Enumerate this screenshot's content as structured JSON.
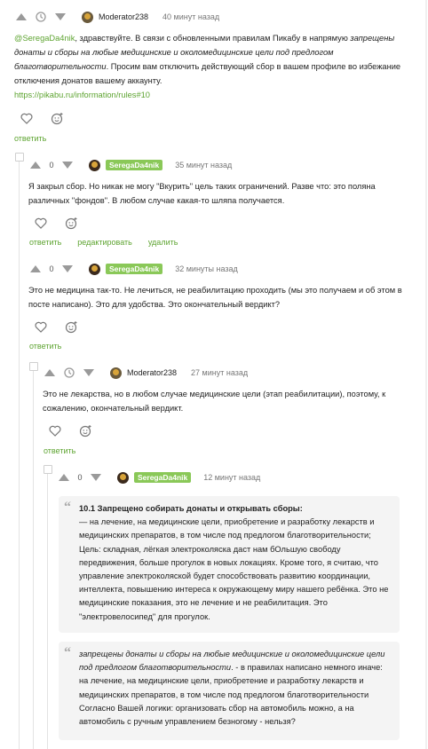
{
  "comment1": {
    "rating": "",
    "nick": "Moderator238",
    "time": "40 минут назад",
    "mention": "@SeregaDa4nik",
    "text_a": ", здравствуйте. В связи с обновленными правилам Пикабу в напрямую ",
    "text_italic": "запрещены донаты и сборы на любые медицинские и околомедицинские цели под предлогом благотворительности",
    "text_b": ". Просим вам отключить действующий сбор в вашем профиле во избежание отключения донатов вашему аккаунту.",
    "link": "https://pikabu.ru/information/rules#10",
    "reply": "ответить"
  },
  "comment2": {
    "rating": "0",
    "nick": "SeregaDa4nik",
    "time": "35 минут назад",
    "text": "Я закрыл сбор. Но никак не могу \"Вкурить\" цель таких ограничений. Разве что: это поляна различных \"фондов\". В любом случае какая-то шляпа получается.",
    "reply": "ответить",
    "edit": "редактировать",
    "delete": "удалить"
  },
  "comment3": {
    "rating": "0",
    "nick": "SeregaDa4nik",
    "time": "32 минуты назад",
    "text": "Это не медицина так-то. Не лечиться, не реабилитацию проходить (мы это получаем и об этом в посте написано). Это для удобства. Это окончательный вердикт?",
    "reply": "ответить"
  },
  "comment4": {
    "rating": "",
    "nick": "Moderator238",
    "time": "27 минут назад",
    "text": "Это не лекарства, но в любом случае медицинские цели (этап реабилитации), поэтому, к сожалению, окончательный вердикт.",
    "reply": "ответить"
  },
  "comment5": {
    "rating": "0",
    "nick": "SeregaDa4nik",
    "time": "12 минут назад",
    "quote1_title": "10.1 Запрещено собирать донаты и открывать сборы:",
    "quote1_body": "— на лечение, на медицинские цели, приобретение и разработку лекарств и медицинских препаратов, в том числе под предлогом благотворительности; Цель: складная, лёгкая электроколяска даст нам бОльшую свободу передвижения, больше прогулок в новых локациях. Кроме того, я считаю, что управление электроколяской будет способствовать развитию координации, интеллекта, повышению интереса к окружающему миру нашего ребёнка. Это не медицинские показания, это не лечение и не реабилитация. Это \"электровелосипед\" для прогулок.",
    "quote2_italic": "запрещены донаты и сборы на любые медицинские и околомедицинские цели под предлогом благотворительности",
    "quote2_body": ". - в правилах написано немного иначе: на лечение, на медицинские цели, приобретение и разработку лекарств и медицинских препаратов, в том числе под предлогом благотворительности Согласно Вашей логики: организовать сбор на автомобиль можно, а на автомобиль с ручным управлением безногому - нельзя?"
  },
  "colors": {
    "accent": "#5ea431",
    "badge": "#8ac858"
  }
}
